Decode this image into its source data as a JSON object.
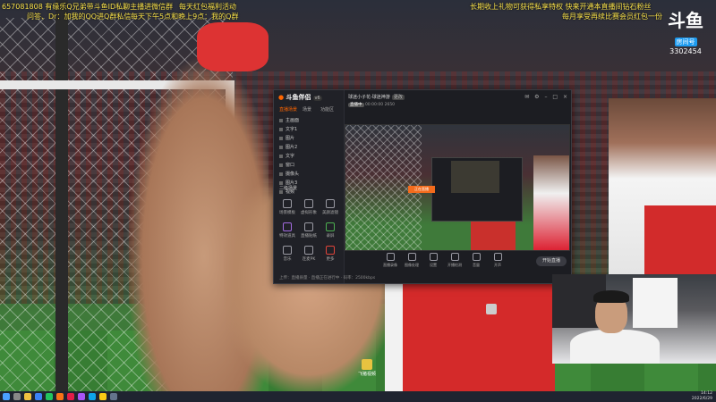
{
  "ticker": {
    "left_top": "657081808  有缘乐Q兄弟带斗鱼ID私聊主播进微信群",
    "left_mid": "问答、Dr：加我的QQ进Q群私信",
    "left_top_right": "每天红包福利活动",
    "left_mid_right": "每天下午5点和晚上9点：我的Q群",
    "right_top": "长期收上礼物可获得私享特权   快来开通本直播间钻石粉丝",
    "right_mid": "每月享受再续比赛会员红包一份"
  },
  "logo": {
    "mark": "斗鱼",
    "sub": "房间号",
    "room_number": "3302454"
  },
  "app": {
    "brand": "斗鱼伴侣",
    "version": "v6",
    "tabs": [
      "直播场景",
      "场景",
      "功能区"
    ],
    "sources": [
      "主画面",
      "文字1",
      "图片",
      "图片2",
      "文字",
      "窗口",
      "摄像头",
      "图片3",
      "视频"
    ],
    "scene_label": "二级场景",
    "tools": [
      "场景模板",
      "虚拟形象",
      "美颜滤镜",
      "特效道具",
      "直播贴纸",
      "录屏",
      "音乐",
      "连麦PK",
      "更多"
    ],
    "title": "球迷小子花-球迷神游",
    "title_badge": "更改",
    "status_live": "直播中",
    "status_time": "00:00:00",
    "status_viewers": "2650",
    "preview_label": "正在直播",
    "bottom_buttons": [
      "直播录像",
      "图像处理",
      "设置",
      "开播检测",
      "音量",
      "开声"
    ],
    "go_live": "开始直播",
    "footer": "上传：直播质量  ·  直播正在进行中  ·  码率：2500kbps"
  },
  "taskbar": {
    "time": "14:12",
    "date": "2022/6/29",
    "desktop_icon": "飞猪视频"
  }
}
